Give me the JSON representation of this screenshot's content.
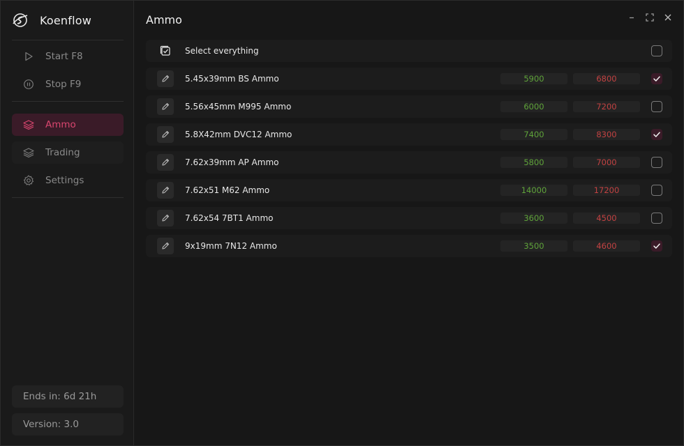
{
  "app": {
    "name": "Koenflow",
    "logo_icon": "koenflow-logo-icon"
  },
  "sidebar": {
    "top_items": [
      {
        "label": "Start F8",
        "icon": "play-icon"
      },
      {
        "label": "Stop F9",
        "icon": "pause-icon"
      }
    ],
    "nav_items": [
      {
        "label": "Ammo",
        "icon": "layers-icon",
        "active": true
      },
      {
        "label": "Trading",
        "icon": "layers-icon",
        "active": false
      },
      {
        "label": "Settings",
        "icon": "gear-icon",
        "active": false
      }
    ],
    "footer": {
      "ends_in": "Ends in: 6d 21h",
      "version": "Version: 3.0"
    }
  },
  "main": {
    "title": "Ammo",
    "select_all": {
      "label": "Select everything",
      "checked": false
    },
    "rows": [
      {
        "name": "5.45x39mm BS Ammo",
        "buy": "5900",
        "sell": "6800",
        "checked": true
      },
      {
        "name": "5.56x45mm M995 Ammo",
        "buy": "6000",
        "sell": "7200",
        "checked": false
      },
      {
        "name": "5.8X42mm DVC12 Ammo",
        "buy": "7400",
        "sell": "8300",
        "checked": true
      },
      {
        "name": "7.62x39mm AP Ammo",
        "buy": "5800",
        "sell": "7000",
        "checked": false
      },
      {
        "name": "7.62x51 M62 Ammo",
        "buy": "14000",
        "sell": "17200",
        "checked": false
      },
      {
        "name": "7.62x54 7BT1 Ammo",
        "buy": "3600",
        "sell": "4500",
        "checked": false
      },
      {
        "name": "9x19mm 7N12 Ammo",
        "buy": "3500",
        "sell": "4600",
        "checked": true
      }
    ]
  },
  "colors": {
    "accent": "#d9466f",
    "accent_bg": "#3a1b28",
    "buy_green": "#5fa33a",
    "sell_red": "#c24242"
  }
}
